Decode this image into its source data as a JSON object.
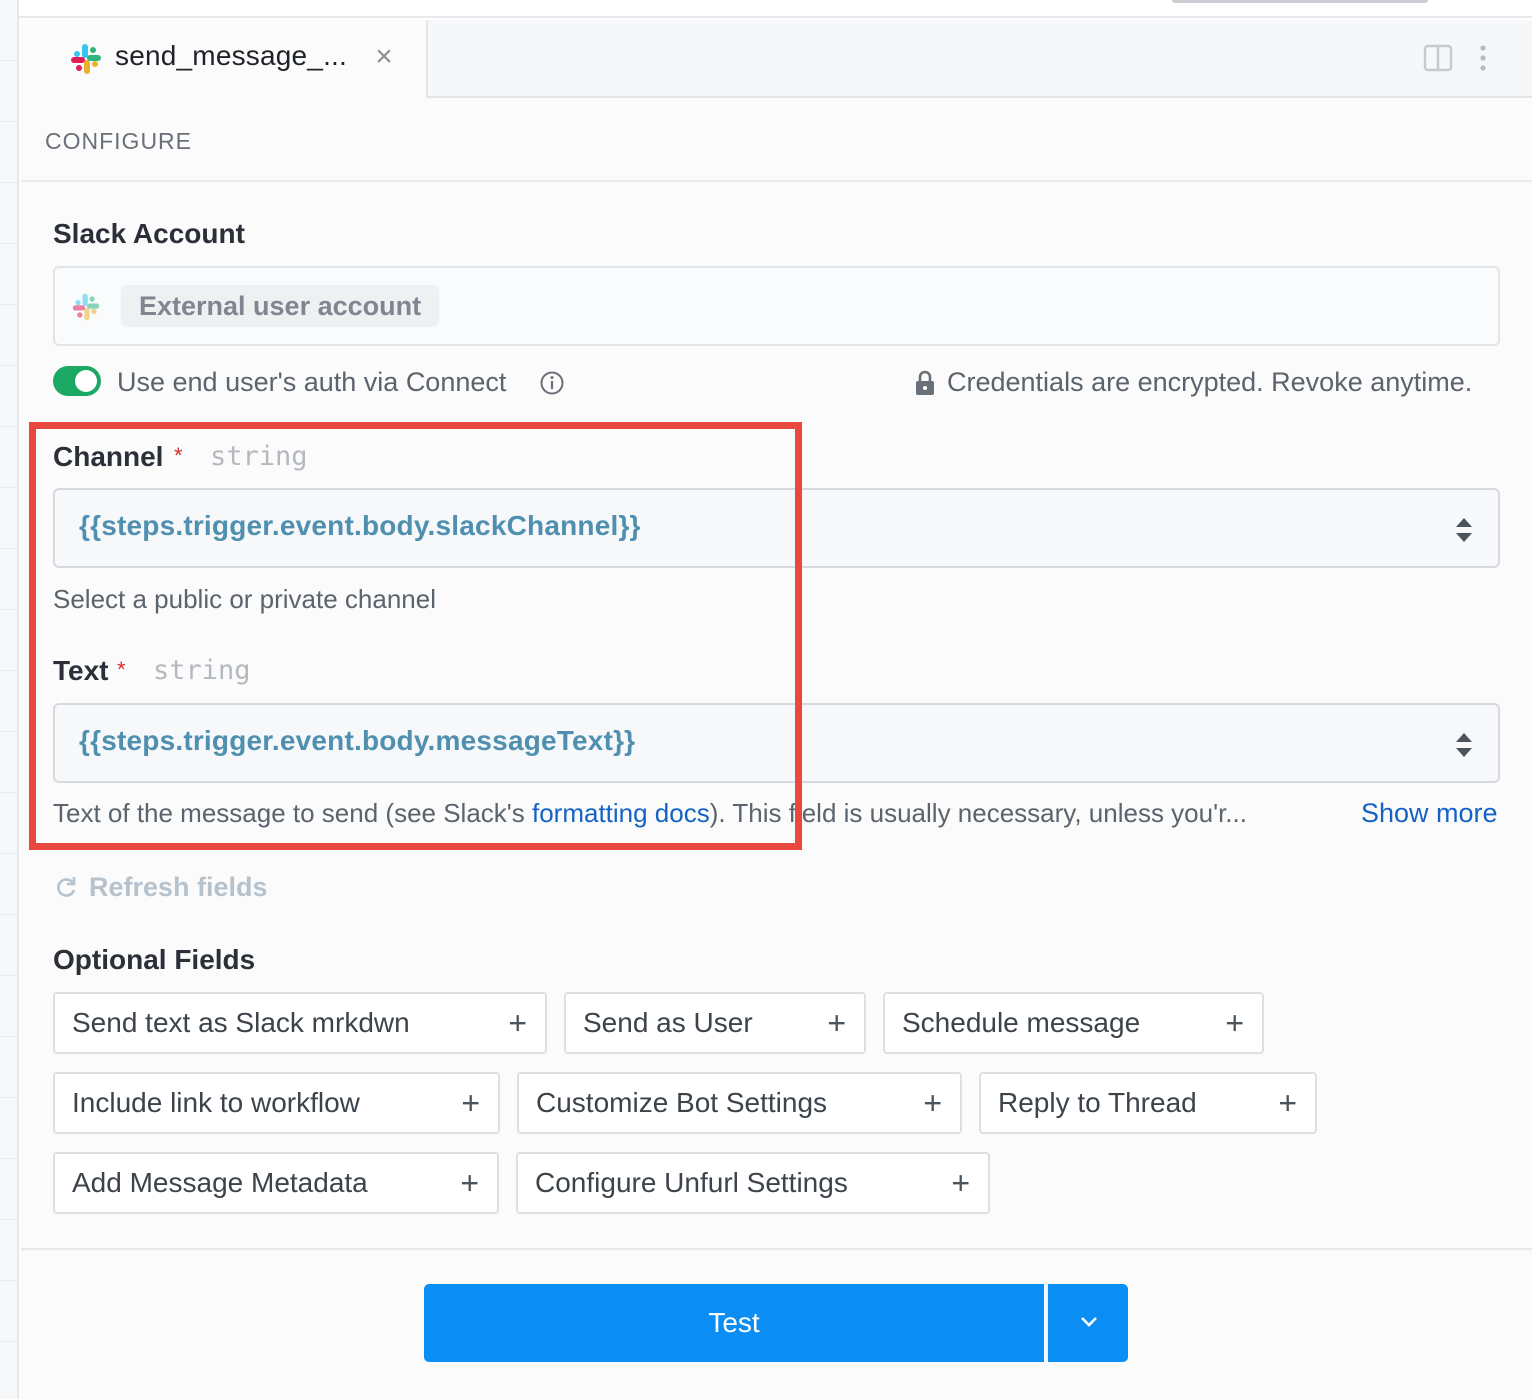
{
  "tab": {
    "title": "send_message_...",
    "close_glyph": "×",
    "icon": "slack-logo-icon"
  },
  "toolbar": {
    "split_view_icon": "split-view-icon",
    "more_icon": "more-vertical-icon"
  },
  "section": {
    "configure_label": "CONFIGURE"
  },
  "slack_account": {
    "label": "Slack Account",
    "value": "External user account",
    "icon": "slack-logo-icon"
  },
  "connect": {
    "toggle_on": true,
    "label": "Use end user's auth via Connect",
    "info_icon": "info-icon",
    "lock_icon": "lock-icon",
    "credentials_text": "Credentials are encrypted. Revoke anytime."
  },
  "fields": {
    "channel": {
      "label": "Channel",
      "required_mark": "*",
      "type": "string",
      "value": "{{steps.trigger.event.body.slackChannel}}",
      "helper": "Select a public or private channel"
    },
    "text": {
      "label": "Text",
      "required_mark": "*",
      "type": "string",
      "value": "{{steps.trigger.event.body.messageText}}",
      "helper_prefix": "Text of the message to send (see Slack's ",
      "helper_link": "formatting docs",
      "helper_suffix": "). This field is usually necessary, unless you'r...",
      "show_more": "Show more"
    }
  },
  "refresh": {
    "label": "Refresh fields",
    "icon": "refresh-icon"
  },
  "optional": {
    "heading": "Optional Fields",
    "items": [
      {
        "label": "Send text as Slack mrkdwn"
      },
      {
        "label": "Send as User"
      },
      {
        "label": "Schedule message"
      },
      {
        "label": "Include link to workflow"
      },
      {
        "label": "Customize Bot Settings"
      },
      {
        "label": "Reply to Thread"
      },
      {
        "label": "Add Message Metadata"
      },
      {
        "label": "Configure Unfurl Settings"
      }
    ],
    "plus_glyph": "+"
  },
  "footer": {
    "test_label": "Test",
    "dropdown_icon": "chevron-down-icon"
  },
  "colors": {
    "accent_blue": "#0a8ef3",
    "toggle_green": "#1aa863",
    "highlight_red": "#e8483f",
    "expression_blue": "#4f8fb0",
    "link_blue": "#1463c4"
  }
}
